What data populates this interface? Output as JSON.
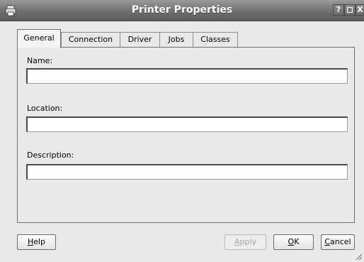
{
  "window": {
    "title": "Printer Properties",
    "help_button": "?",
    "close_button": "X"
  },
  "tabs": [
    {
      "label": "General",
      "active": true
    },
    {
      "label": "Connection",
      "active": false
    },
    {
      "label": "Driver",
      "active": false
    },
    {
      "label": "Jobs",
      "active": false
    },
    {
      "label": "Classes",
      "active": false
    }
  ],
  "form": {
    "name_label": "Name:",
    "name_value": "",
    "location_label": "Location:",
    "location_value": "",
    "description_label": "Description:",
    "description_value": ""
  },
  "buttons": {
    "help": {
      "mnemonic": "H",
      "rest": "elp"
    },
    "apply": {
      "mnemonic": "A",
      "rest": "pply",
      "enabled": false
    },
    "ok": {
      "mnemonic": "O",
      "rest": "K"
    },
    "cancel": {
      "mnemonic": "C",
      "rest": "ancel"
    }
  }
}
